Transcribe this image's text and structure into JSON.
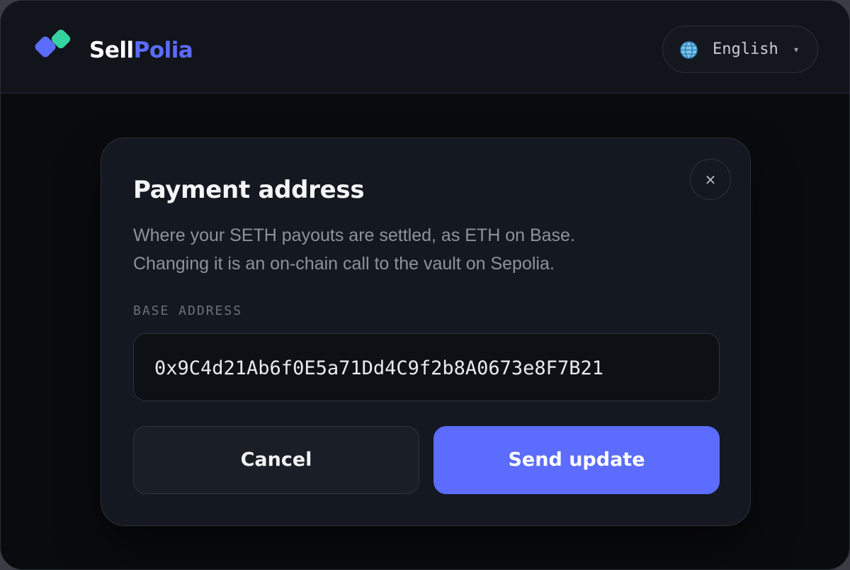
{
  "header": {
    "brand_part1": "Sell",
    "brand_part2": "Polia",
    "brand_colors": {
      "primary": "#5b6cff",
      "secondary": "#34d3a0"
    },
    "language": {
      "icon": "globe-icon",
      "label": "English",
      "caret": "▾"
    }
  },
  "modal": {
    "title": "Payment address",
    "description_line1": "Where your SETH payouts are settled, as ETH on Base.",
    "description_line2": "Changing it is an on-chain call to the vault on Sepolia.",
    "close_icon": "close-icon",
    "close_glyph": "×",
    "field_label": "BASE ADDRESS",
    "address_value": "0x9C4d21Ab6f0E5a71Dd4C9f2b8A0673e8F7B21",
    "cancel_label": "Cancel",
    "submit_label": "Send update"
  }
}
